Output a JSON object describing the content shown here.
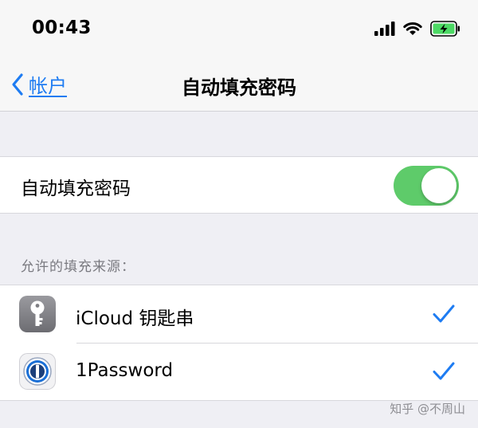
{
  "status_bar": {
    "time": "00:43",
    "icons": [
      "signal-icon",
      "wifi-icon",
      "battery-charging-icon"
    ],
    "battery_color": "#4cd964"
  },
  "nav": {
    "back_label": "帐户",
    "title": "自动填充密码",
    "accent_color": "#1e7cf2"
  },
  "autofill_row": {
    "label": "自动填充密码",
    "toggle_on": true,
    "toggle_color": "#5ecb6a"
  },
  "sources": {
    "header": "允许的填充来源：",
    "items": [
      {
        "label": "iCloud 钥匙串",
        "icon": "icloud-keychain-icon",
        "checked": true
      },
      {
        "label": "1Password",
        "icon": "1password-icon",
        "checked": true
      }
    ]
  },
  "watermark": "知乎 @不周山"
}
